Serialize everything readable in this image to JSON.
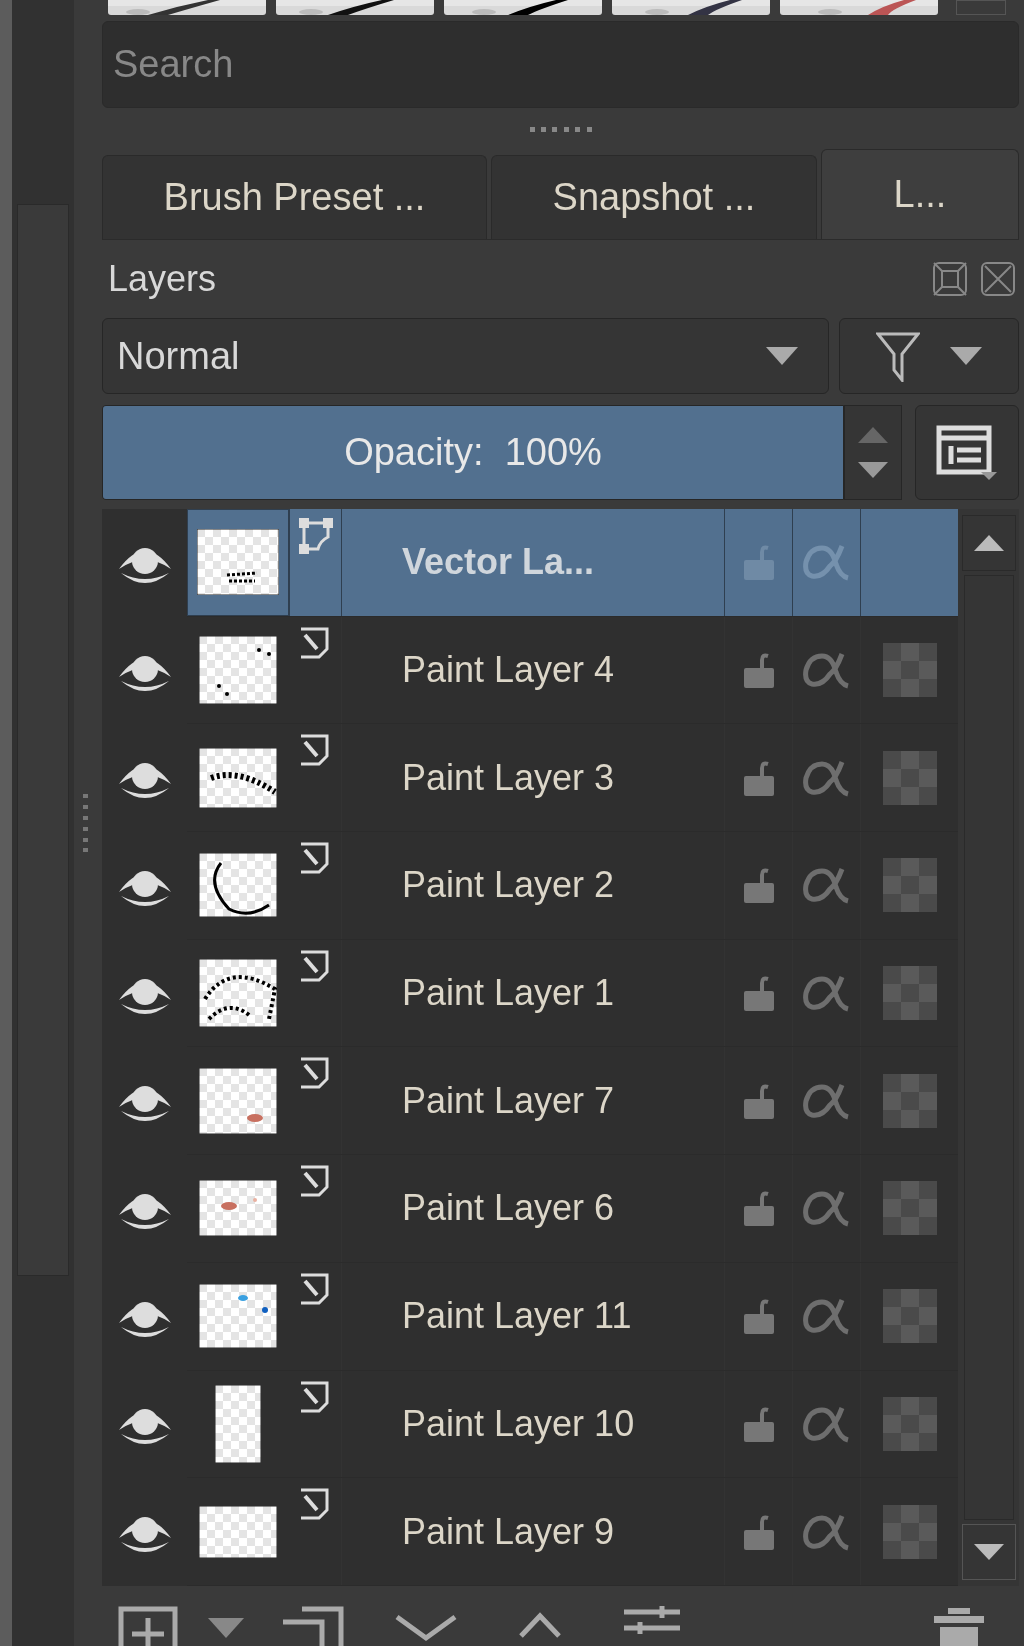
{
  "search": {
    "placeholder": "Search"
  },
  "tabs": [
    {
      "label": "Brush Preset ...",
      "selected": false
    },
    {
      "label": "Snapshot ...",
      "selected": false
    },
    {
      "label": "L...",
      "selected": true
    }
  ],
  "panel": {
    "title": "Layers",
    "blend_mode": "Normal",
    "opacity": {
      "label": "Opacity:  100%",
      "level": 1
    }
  },
  "layers": [
    {
      "name": "Vector La...",
      "kind": "vector",
      "selected": true,
      "visible": true
    },
    {
      "name": "Paint Layer 4",
      "kind": "paint",
      "selected": false,
      "visible": true
    },
    {
      "name": "Paint Layer 3",
      "kind": "paint",
      "selected": false,
      "visible": true
    },
    {
      "name": "Paint Layer 2",
      "kind": "paint",
      "selected": false,
      "visible": true
    },
    {
      "name": "Paint Layer 1",
      "kind": "paint",
      "selected": false,
      "visible": true
    },
    {
      "name": "Paint Layer 7",
      "kind": "paint",
      "selected": false,
      "visible": true
    },
    {
      "name": "Paint Layer 6",
      "kind": "paint",
      "selected": false,
      "visible": true
    },
    {
      "name": "Paint Layer 11",
      "kind": "paint",
      "selected": false,
      "visible": true
    },
    {
      "name": "Paint Layer 10",
      "kind": "paint",
      "selected": false,
      "visible": true
    },
    {
      "name": "Paint Layer 9",
      "kind": "paint",
      "selected": false,
      "visible": true
    }
  ]
}
